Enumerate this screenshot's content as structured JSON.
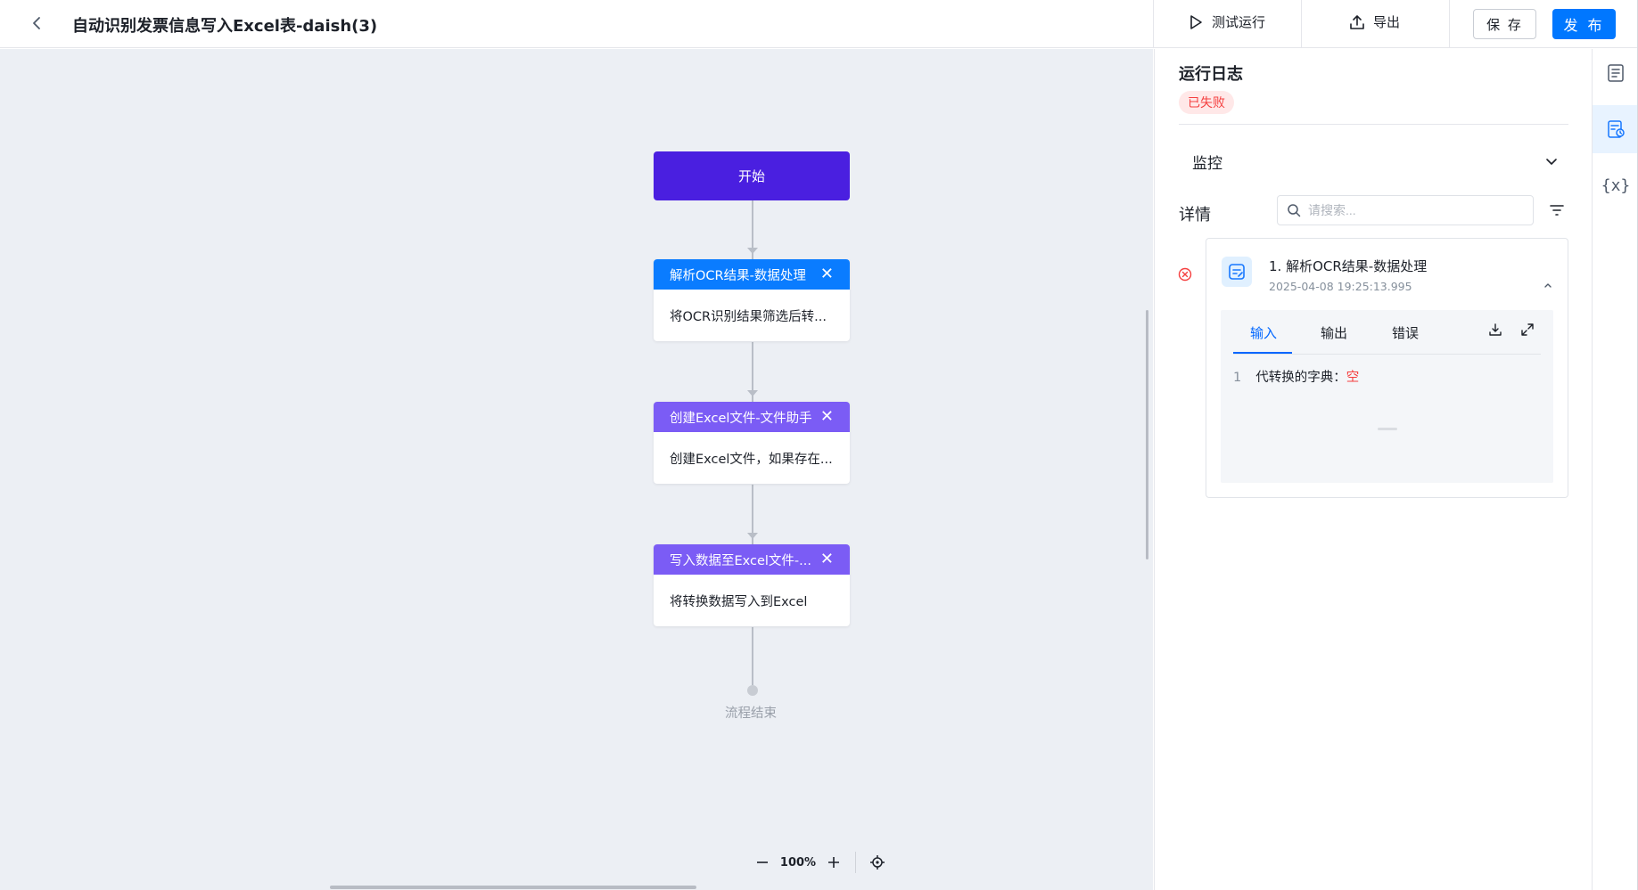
{
  "header": {
    "title": "自动识别发票信息写入Excel表-daish(3)",
    "test_run_label": "测试运行",
    "export_label": "导出",
    "save_label": "保 存",
    "publish_label": "发 布"
  },
  "canvas": {
    "start_label": "开始",
    "nodes": [
      {
        "title": "解析OCR结果-数据处理",
        "description": "将OCR识别结果筛选后转...",
        "color": "#0a7cff"
      },
      {
        "title": "创建Excel文件-文件助手",
        "description": "创建Excel文件，如果存在...",
        "color": "#7b5cf5"
      },
      {
        "title": "写入数据至Excel文件-...",
        "description": "将转换数据写入到Excel",
        "color": "#7b5cf5"
      }
    ],
    "end_label": "流程结束",
    "zoom_level": "100%"
  },
  "panel": {
    "title": "运行日志",
    "status": "已失败",
    "monitor_label": "监控",
    "detail_label": "详情",
    "search_placeholder": "请搜索...",
    "log_entry": {
      "title": "1. 解析OCR结果-数据处理",
      "timestamp": "2025-04-08 19:25:13.995",
      "tabs": [
        "输入",
        "输出",
        "错误"
      ],
      "active_tab": "输入",
      "lines": [
        {
          "number": "1",
          "key": "代转换的字典：",
          "value": "空"
        }
      ]
    }
  },
  "colors": {
    "accent": "#0077ff",
    "start_node": "#4a1fe0",
    "error": "#f53f3f",
    "canvas_bg": "#eceff4"
  },
  "icons": {
    "back": "chevron-left-icon",
    "test_run": "play-icon",
    "export": "upload-icon",
    "monitor_toggle": "chevron-down-icon",
    "search": "search-icon",
    "filter": "filter-icon",
    "error": "error-circle-icon",
    "step": "edit-document-icon",
    "collapse": "chevron-up-icon",
    "download": "download-icon",
    "fullscreen": "expand-icon",
    "zoom_out": "minus-icon",
    "zoom_in": "plus-icon",
    "locate": "locate-icon",
    "rail": [
      "document-list-icon",
      "run-log-icon",
      "variable-icon"
    ]
  }
}
